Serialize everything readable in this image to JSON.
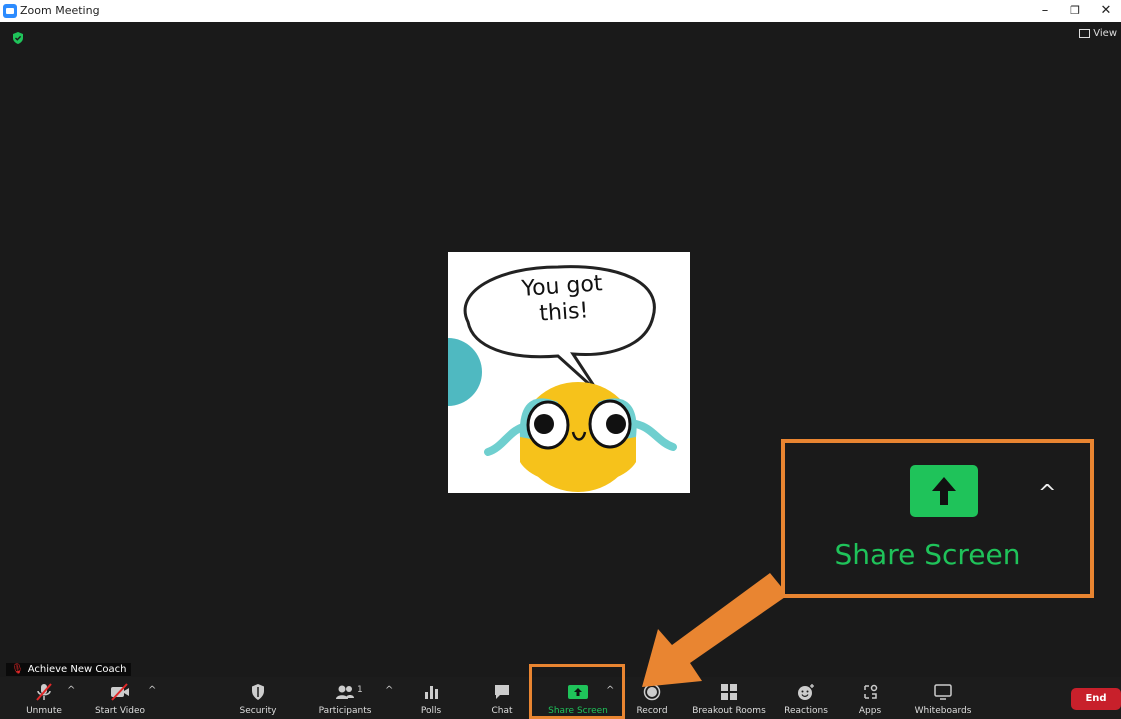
{
  "window": {
    "title": "Zoom Meeting",
    "minimize": "–",
    "restore": "❐",
    "close": "✕"
  },
  "header": {
    "view_label": "View"
  },
  "meme": {
    "line1": "You got",
    "line2": "this!"
  },
  "participant": {
    "name": "Achieve New Coach"
  },
  "toolbar": {
    "unmute": "Unmute",
    "start_video": "Start Video",
    "security": "Security",
    "participants": "Participants",
    "participants_count": "1",
    "polls": "Polls",
    "chat": "Chat",
    "share_screen": "Share Screen",
    "record": "Record",
    "breakout_rooms": "Breakout Rooms",
    "reactions": "Reactions",
    "apps": "Apps",
    "whiteboards": "Whiteboards",
    "end": "End"
  },
  "callout": {
    "label": "Share Screen"
  },
  "colors": {
    "accent_green": "#1fc35a",
    "highlight_orange": "#e98531",
    "end_red": "#c8202b",
    "mute_red": "#e02828"
  }
}
